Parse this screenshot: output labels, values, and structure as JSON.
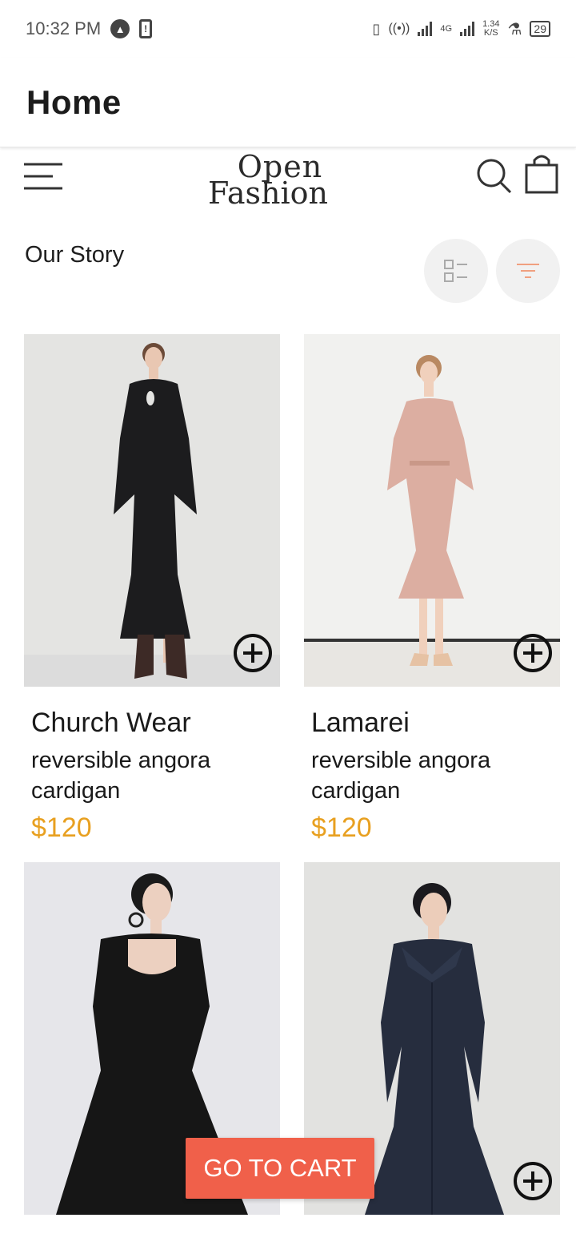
{
  "status_bar": {
    "time": "10:32 PM",
    "network_type": "4G",
    "speed_value": "1.34",
    "speed_unit": "K/S",
    "battery": "29"
  },
  "app_bar": {
    "title": "Home"
  },
  "header": {
    "logo_line1": "Open",
    "logo_line2": "Fashion",
    "icons": [
      "menu-icon",
      "search-icon",
      "shopping-bag-icon"
    ]
  },
  "section": {
    "title": "Our Story",
    "view_icon": "list-view-icon",
    "filter_icon": "filter-icon",
    "filter_color": "#f0a080"
  },
  "products": [
    {
      "name": "Church Wear",
      "desc": "reversible angora cardigan",
      "price": "$120"
    },
    {
      "name": "Lamarei",
      "desc": "reversible angora cardigan",
      "price": "$120"
    },
    {
      "name": "",
      "desc": "",
      "price": ""
    },
    {
      "name": "",
      "desc": "",
      "price": ""
    }
  ],
  "cart_button": {
    "label": "GO TO CART",
    "color": "#f0604a"
  },
  "colors": {
    "price": "#e8a020",
    "accent": "#f0604a"
  }
}
